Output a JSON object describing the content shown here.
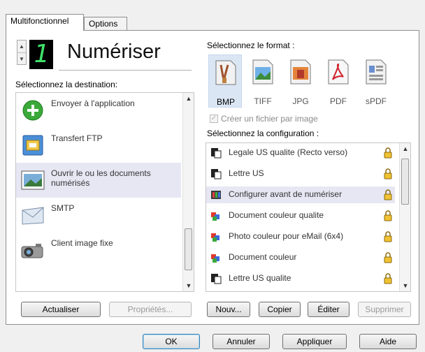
{
  "tabs": [
    {
      "label": "Multifonctionnel",
      "active": true
    },
    {
      "label": "Options",
      "active": false
    }
  ],
  "header": {
    "digit": "1",
    "title": "Numériser"
  },
  "destination": {
    "label": "Sélectionnez la destination:",
    "items": [
      {
        "label": "Envoyer à l'application",
        "icon": "green-add-icon",
        "selected": false
      },
      {
        "label": "Transfert FTP",
        "icon": "ftp-transfer-icon",
        "selected": false
      },
      {
        "label": "Ouvrir le ou les documents numérisés",
        "icon": "open-document-icon",
        "selected": true
      },
      {
        "label": "SMTP",
        "icon": "email-envelope-icon",
        "selected": false
      },
      {
        "label": "Client image fixe",
        "icon": "camera-icon",
        "selected": false
      }
    ]
  },
  "format": {
    "label": "Sélectionnez le format :",
    "items": [
      {
        "label": "BMP",
        "selected": true
      },
      {
        "label": "TIFF",
        "selected": false
      },
      {
        "label": "JPG",
        "selected": false
      },
      {
        "label": "PDF",
        "selected": false
      },
      {
        "label": "sPDF",
        "selected": false
      }
    ],
    "checkbox_label": "Créer un fichier par image"
  },
  "configuration": {
    "label": "Sélectionnez la configuration :",
    "items": [
      {
        "label": "Legale US qualite (Recto verso)",
        "icon": "bw-document-icon",
        "selected": false
      },
      {
        "label": "Lettre US",
        "icon": "bw-document-icon",
        "selected": false
      },
      {
        "label": "Configurer avant de numériser",
        "icon": "configure-icon",
        "selected": true
      },
      {
        "label": "Document couleur qualite",
        "icon": "color-document-icon",
        "selected": false
      },
      {
        "label": "Photo couleur pour eMail (6x4)",
        "icon": "color-document-icon",
        "selected": false
      },
      {
        "label": "Document couleur",
        "icon": "color-document-icon",
        "selected": false
      },
      {
        "label": "Lettre US qualite",
        "icon": "bw-document-icon",
        "selected": false
      }
    ]
  },
  "buttons": {
    "refresh": "Actualiser",
    "properties": "Propriétés...",
    "new": "Nouv...",
    "copy": "Copier",
    "edit": "Éditer",
    "delete": "Supprimer",
    "ok": "OK",
    "cancel": "Annuler",
    "apply": "Appliquer",
    "help": "Aide"
  },
  "colors": {
    "selection": "#e7e7f4",
    "format_selection": "#dbe6f4",
    "digit_color": "#3fe06a"
  }
}
